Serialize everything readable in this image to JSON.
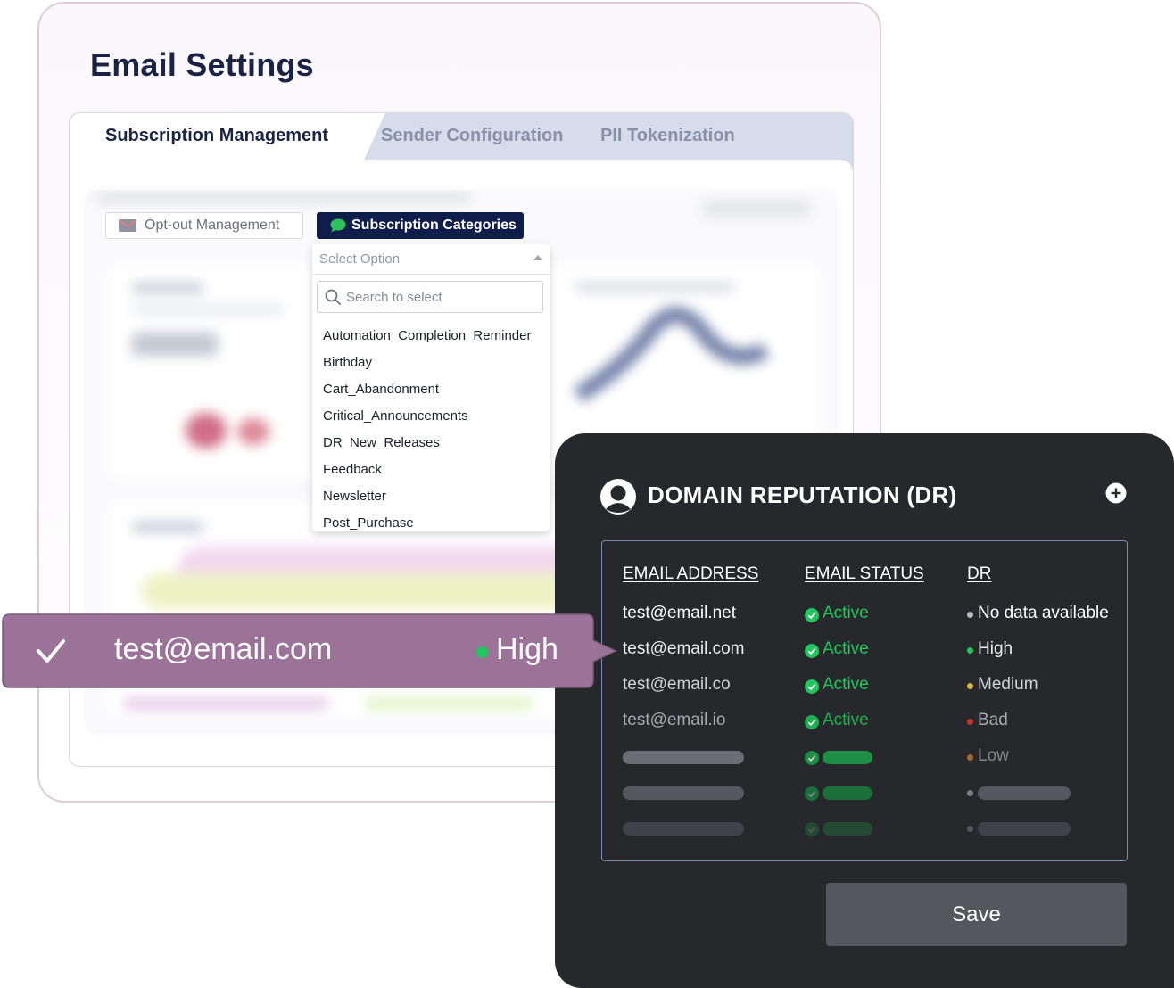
{
  "settings": {
    "title": "Email Settings",
    "tabs": [
      {
        "label": "Subscription Management",
        "active": true
      },
      {
        "label": "Sender Configuration",
        "active": false
      },
      {
        "label": "PII Tokenization",
        "active": false
      }
    ],
    "sub_tabs": {
      "optout": {
        "label": "Opt-out Management",
        "icon": "mail-icon"
      },
      "subscriptions": {
        "label": "Subscription Categories",
        "icon": "chat-bubble-icon"
      }
    },
    "dropdown": {
      "placeholder": "Select Option",
      "search_placeholder": "Search to select",
      "options": [
        "Automation_Completion_Reminder",
        "Birthday",
        "Cart_Abandonment",
        "Critical_Announcements",
        "DR_New_Releases",
        "Feedback",
        "Newsletter",
        "Post_Purchase"
      ]
    }
  },
  "domain_reputation": {
    "title": "DOMAIN REPUTATION (DR)",
    "columns": {
      "email": "EMAIL ADDRESS",
      "status": "EMAIL STATUS",
      "dr": "DR"
    },
    "rows": [
      {
        "email": "test@email.net",
        "status": "Active",
        "dr": "No data available",
        "dr_color": "#b8bcc4"
      },
      {
        "email": "test@email.com",
        "status": "Active",
        "dr": "High",
        "dr_color": "#22c55e"
      },
      {
        "email": "test@email.co",
        "status": "Active",
        "dr": "Medium",
        "dr_color": "#d6b743"
      },
      {
        "email": "test@email.io",
        "status": "Active",
        "dr": "Bad",
        "dr_color": "#c0392b"
      },
      {
        "email": "",
        "status": "",
        "dr": "Low",
        "dr_color": "#a06a3a"
      }
    ],
    "save_label": "Save"
  },
  "highlight": {
    "email": "test@email.com",
    "level": "High"
  },
  "colors": {
    "accent_navy": "#0f1d4a",
    "active_green": "#22c55e",
    "callout_purple": "#9b7398",
    "dark_panel": "#26282c"
  }
}
